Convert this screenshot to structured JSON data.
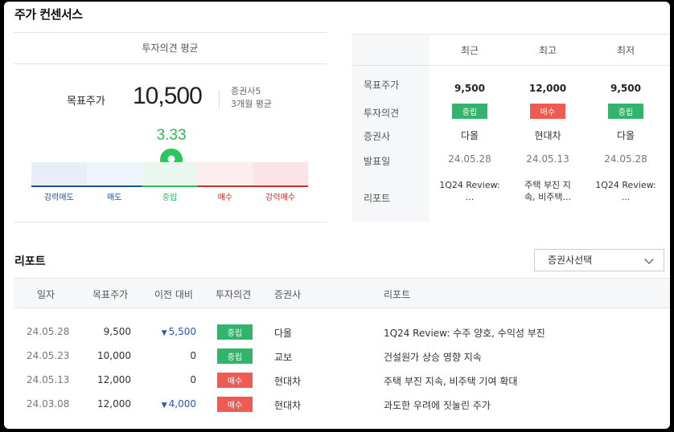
{
  "section_title": "주가 컨센서스",
  "summary": {
    "header": "투자의견 평균",
    "target_label": "목표주가",
    "target_value": "10,500",
    "broker_count": "증권사5",
    "period": "3개월 평균",
    "score": "3.33",
    "score_value": 3.33,
    "scale_labels": [
      "강력매도",
      "매도",
      "중립",
      "매수",
      "강력매수"
    ],
    "scale_colors": [
      "#1f4fa3",
      "#1f4fa3",
      "#2cb95a",
      "#c9302c",
      "#c9302c"
    ],
    "seg_colors": [
      "#e8eef8",
      "#eef4fc",
      "#e9f7ee",
      "#fdeeee",
      "#fbe4e5"
    ]
  },
  "comparison": {
    "columns": [
      "최근",
      "최고",
      "최저"
    ],
    "row_labels": [
      "목표주가",
      "투자의견",
      "증권사",
      "발표일",
      "리포트"
    ],
    "target_prices": [
      "9,500",
      "12,000",
      "9,500"
    ],
    "opinions": [
      {
        "label": "중립",
        "type": "neutral"
      },
      {
        "label": "매수",
        "type": "buy"
      },
      {
        "label": "중립",
        "type": "neutral"
      }
    ],
    "brokers": [
      "다올",
      "현대차",
      "다올"
    ],
    "dates": [
      "24.05.28",
      "24.05.13",
      "24.05.28"
    ],
    "reports": [
      [
        "1Q24 Review:",
        "..."
      ],
      [
        "주택 부진 지",
        "속, 비주택..."
      ],
      [
        "1Q24 Review:",
        "..."
      ]
    ]
  },
  "reports": {
    "title": "리포트",
    "broker_select": "증권사선택",
    "columns": [
      "일자",
      "목표주가",
      "이전 대비",
      "투자의견",
      "증권사",
      "리포트"
    ],
    "rows": [
      {
        "date": "24.05.28",
        "target": "9,500",
        "diff": "5,500",
        "diff_dir": "down",
        "opinion": "중립",
        "opinion_type": "neutral",
        "broker": "다올",
        "report": "1Q24 Review: 수주 양호, 수익성 부진"
      },
      {
        "date": "24.05.23",
        "target": "10,000",
        "diff": "0",
        "diff_dir": "none",
        "opinion": "중립",
        "opinion_type": "neutral",
        "broker": "교보",
        "report": "건설원가 상승 영향 지속"
      },
      {
        "date": "24.05.13",
        "target": "12,000",
        "diff": "0",
        "diff_dir": "none",
        "opinion": "매수",
        "opinion_type": "buy",
        "broker": "현대차",
        "report": "주택 부진 지속, 비주택 기여 확대"
      },
      {
        "date": "24.03.08",
        "target": "12,000",
        "diff": "4,000",
        "diff_dir": "down",
        "opinion": "매수",
        "opinion_type": "buy",
        "broker": "현대차",
        "report": "과도한 우려에 짓눌린 주가"
      }
    ]
  }
}
